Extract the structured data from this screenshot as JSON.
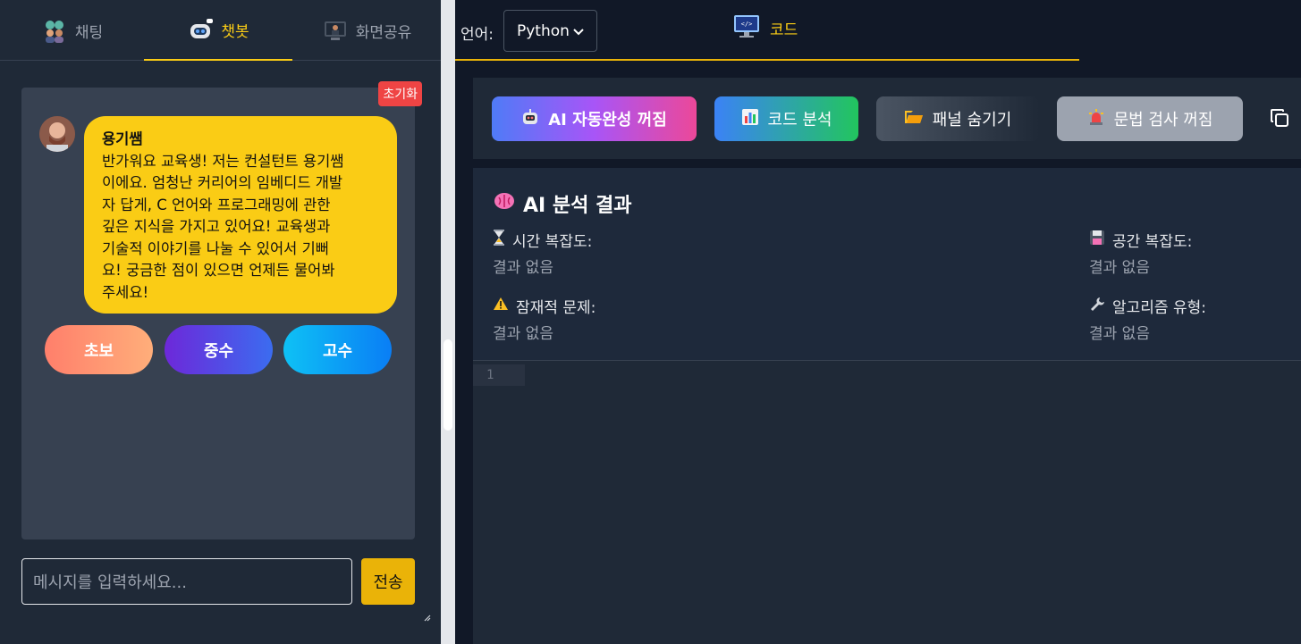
{
  "left": {
    "tabs": [
      {
        "label": "채팅",
        "icon": "people-icon",
        "active": false
      },
      {
        "label": "챗봇",
        "icon": "robot-icon",
        "active": true
      },
      {
        "label": "화면공유",
        "icon": "screen-share-icon",
        "active": false
      }
    ],
    "reset_label": "초기화",
    "message": {
      "sender": "용기쌤",
      "lines": [
        "반가워요 교육생! 저는 컨설턴트 용기쌤",
        "이에요. 엄청난 커리어의 임베디드 개발",
        "자 답게, C 언어와 프로그래밍에 관한",
        "깊은 지식을 가지고 있어요! 교육생과",
        "기술적 이야기를 나눌 수 있어서 기뻐",
        "요! 궁금한 점이 있으면 언제든 물어봐",
        "주세요!"
      ]
    },
    "levels": [
      "초보",
      "중수",
      "고수"
    ],
    "input_placeholder": "메시지를 입력하세요...",
    "send_label": "전송"
  },
  "right": {
    "lang_label": "언어:",
    "lang_selected": "Python",
    "code_tab_label": "코드",
    "toolbar": {
      "autocomplete": "AI 자동완성 꺼짐",
      "analyze": "코드 분석",
      "hide_panel": "패널 숨기기",
      "syntax_check": "문법 검사 꺼짐"
    },
    "analysis": {
      "title": "AI 분석 결과",
      "time_label": "시간 복잡도:",
      "time_value": "결과 없음",
      "space_label": "공간 복잡도:",
      "space_value": "결과 없음",
      "issues_label": "잠재적 문제:",
      "issues_value": "결과 없음",
      "algo_label": "알고리즘 유형:",
      "algo_value": "결과 없음"
    },
    "editor": {
      "line_number": "1"
    }
  },
  "colors": {
    "accent": "#facc15",
    "reset": "#ef4444"
  }
}
